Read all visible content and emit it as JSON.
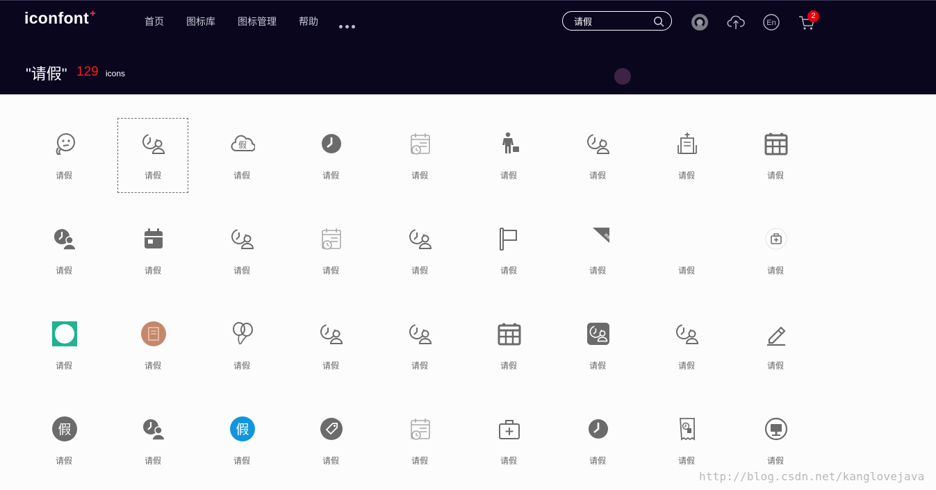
{
  "header": {
    "logo": {
      "text": "iconfont",
      "plus": "+"
    },
    "nav": [
      "首页",
      "图标库",
      "图标管理",
      "帮助"
    ],
    "search": {
      "value": "请假"
    },
    "lang_label": "En",
    "cart_count": "2"
  },
  "results": {
    "title": "\"请假\"",
    "count": "129",
    "unit": "icons"
  },
  "icons": [
    {
      "label": "请假",
      "icon": "face-thinking-icon"
    },
    {
      "label": "请假",
      "icon": "clock-person-icon",
      "selected": true
    },
    {
      "label": "请假",
      "icon": "cloud-jia-icon"
    },
    {
      "label": "请假",
      "icon": "clock-filled-icon"
    },
    {
      "label": "请假",
      "icon": "calendar-list-clock-light-icon"
    },
    {
      "label": "请假",
      "icon": "businessman-briefcase-icon"
    },
    {
      "label": "请假",
      "icon": "clock-person-icon"
    },
    {
      "label": "请假",
      "icon": "hospital-building-icon"
    },
    {
      "label": "请假",
      "icon": "calendar-grid-bold-icon"
    },
    {
      "label": "请假",
      "icon": "clock-person-filled-icon"
    },
    {
      "label": "请假",
      "icon": "calendar-filled-icon"
    },
    {
      "label": "请假",
      "icon": "clock-person-icon"
    },
    {
      "label": "请假",
      "icon": "calendar-list-clock-light-icon"
    },
    {
      "label": "请假",
      "icon": "clock-person-icon"
    },
    {
      "label": "请假",
      "icon": "flag-icon"
    },
    {
      "label": "请假",
      "icon": "corner-ribbon-icon"
    },
    {
      "label": "请假",
      "icon": "blank-icon"
    },
    {
      "label": "请假",
      "icon": "medical-kit-circle-icon"
    },
    {
      "label": "请假",
      "icon": "teal-square-circle-icon"
    },
    {
      "label": "请假",
      "icon": "brown-circle-document-icon"
    },
    {
      "label": "请假",
      "icon": "balloons-icon"
    },
    {
      "label": "请假",
      "icon": "clock-person-icon"
    },
    {
      "label": "请假",
      "icon": "clock-person-icon"
    },
    {
      "label": "请假",
      "icon": "calendar-grid-bold-icon"
    },
    {
      "label": "请假",
      "icon": "clock-person-boxed-icon"
    },
    {
      "label": "请假",
      "icon": "clock-person-icon"
    },
    {
      "label": "请假",
      "icon": "pencil-edit-icon"
    },
    {
      "label": "请假",
      "icon": "circle-jia-gray-icon"
    },
    {
      "label": "请假",
      "icon": "clock-person-filled-icon"
    },
    {
      "label": "请假",
      "icon": "circle-jia-blue-icon"
    },
    {
      "label": "请假",
      "icon": "tag-circle-icon"
    },
    {
      "label": "请假",
      "icon": "calendar-list-clock-light-icon"
    },
    {
      "label": "请假",
      "icon": "medical-case-icon"
    },
    {
      "label": "请假",
      "icon": "clock-filled-icon"
    },
    {
      "label": "请假",
      "icon": "receipt-document-icon"
    },
    {
      "label": "请假",
      "icon": "monitor-circle-icon"
    }
  ],
  "watermark": "http://blog.csdn.net/kanglovejava",
  "colors": {
    "header_bg": "#09061e",
    "count_red": "#ff1a1a",
    "icon_gray": "#666666",
    "badge_red": "#e60012"
  }
}
